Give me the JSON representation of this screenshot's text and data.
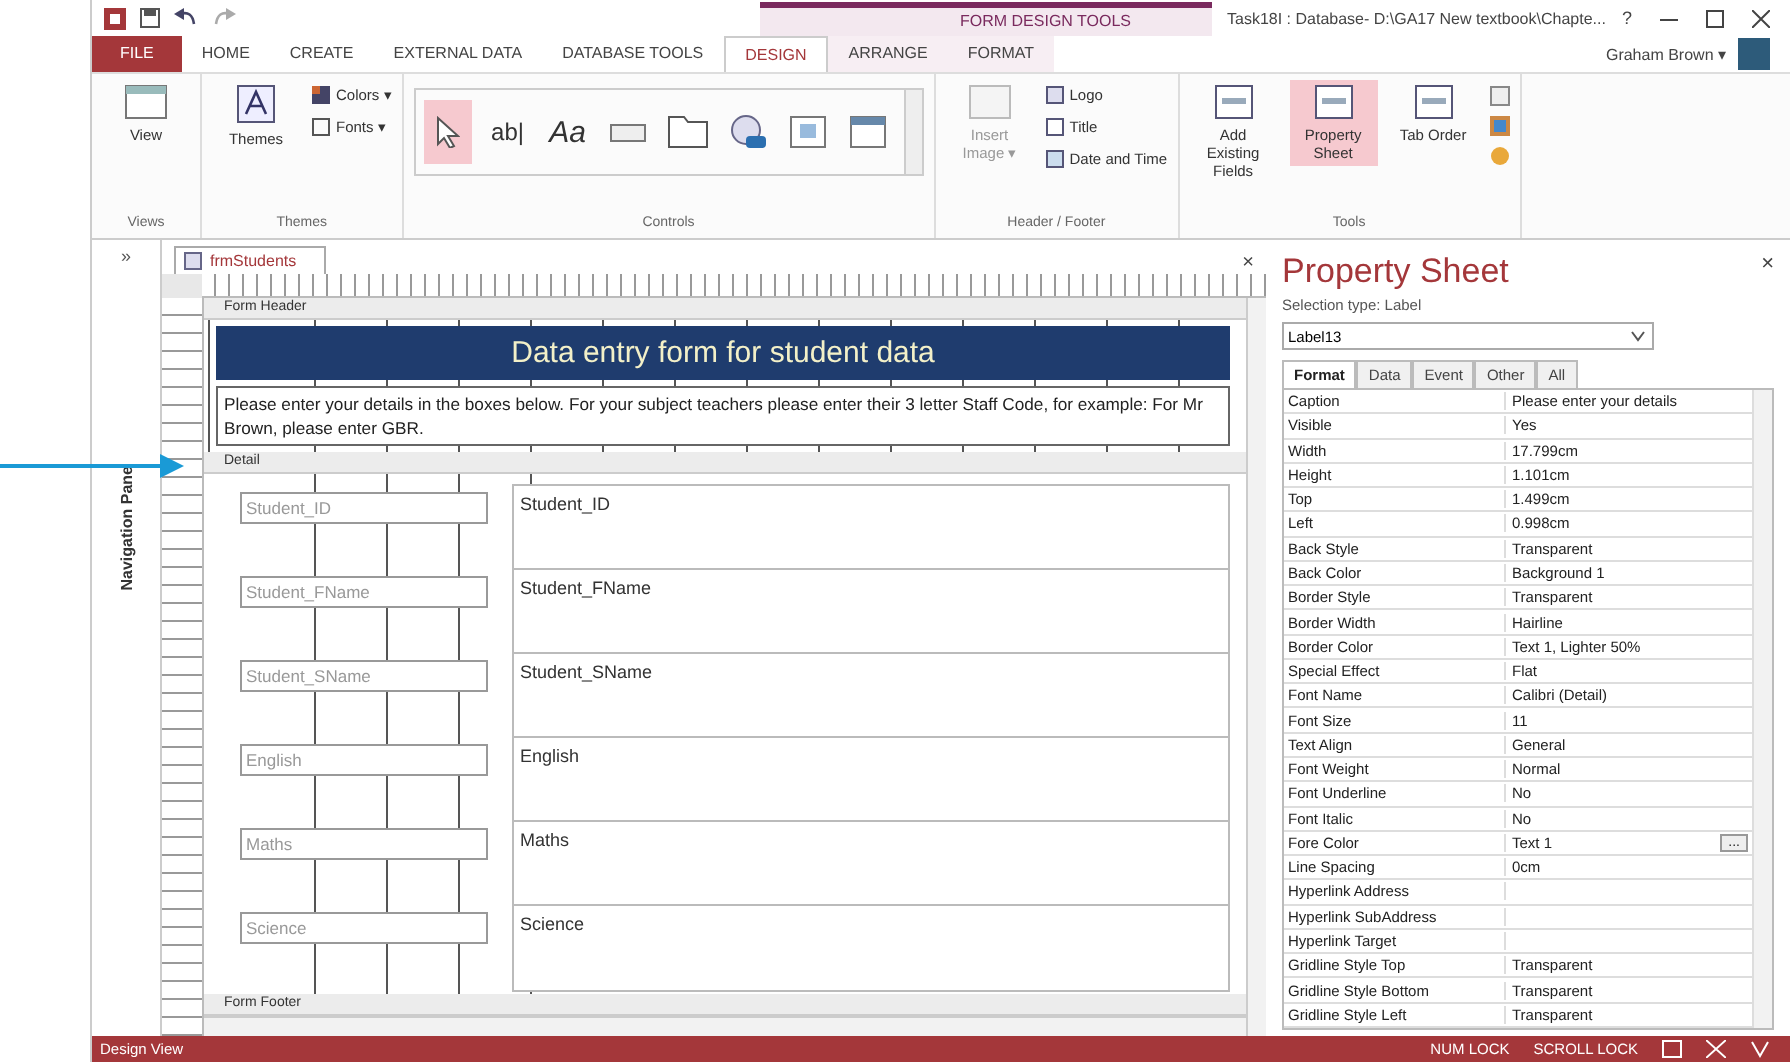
{
  "title_bar": {
    "context_label": "FORM DESIGN TOOLS",
    "title": "Task18I : Database- D:\\GA17 New textbook\\Chapte...",
    "help": "?",
    "user": "Graham Brown ▾"
  },
  "tabs": [
    {
      "label": "FILE",
      "selected": false,
      "kind": "file"
    },
    {
      "label": "HOME",
      "selected": false,
      "kind": "tab"
    },
    {
      "label": "CREATE",
      "selected": false,
      "kind": "tab"
    },
    {
      "label": "EXTERNAL DATA",
      "selected": false,
      "kind": "tab"
    },
    {
      "label": "DATABASE TOOLS",
      "selected": false,
      "kind": "tab"
    },
    {
      "label": "DESIGN",
      "selected": true,
      "kind": "context"
    },
    {
      "label": "ARRANGE",
      "selected": false,
      "kind": "context"
    },
    {
      "label": "FORMAT",
      "selected": false,
      "kind": "context"
    }
  ],
  "ribbon": {
    "views": {
      "name": "Views",
      "view": "View"
    },
    "themes": {
      "name": "Themes",
      "themes": "Themes",
      "colors": "Colors ▾",
      "fonts": "Fonts ▾"
    },
    "controls": {
      "name": "Controls",
      "items": [
        {
          "kind": "pointer",
          "selected": true
        },
        {
          "kind": "textbox",
          "label": "ab|",
          "selected": false
        },
        {
          "kind": "label",
          "label": "Aa",
          "selected": false
        },
        {
          "kind": "button",
          "selected": false
        },
        {
          "kind": "tab",
          "selected": false
        },
        {
          "kind": "hyperlink",
          "selected": false
        },
        {
          "kind": "frame",
          "selected": false
        },
        {
          "kind": "navigation",
          "selected": false
        }
      ]
    },
    "header_footer": {
      "name": "Header / Footer",
      "insert_image": "Insert Image ▾",
      "logo": "Logo",
      "title": "Title",
      "date_time": "Date and Time"
    },
    "tools": {
      "name": "Tools",
      "items": [
        {
          "label": "Add Existing Fields",
          "selected": false
        },
        {
          "label": "Property Sheet",
          "selected": true
        },
        {
          "label": "Tab Order",
          "selected": false
        }
      ]
    }
  },
  "navigation_pane": {
    "toggle": "»",
    "label": "Navigation Pane"
  },
  "document": {
    "tab": "frmStudents",
    "close": "×",
    "form_header": {
      "section": "Form Header",
      "title": "Data entry form for student data",
      "instructions": "Please enter your details in the boxes below. For your subject teachers please enter their 3 letter Staff Code, for example: For Mr Brown, please enter GBR."
    },
    "detail": {
      "section": "Detail",
      "fields": [
        {
          "label": "Student_ID",
          "control": "Student_ID"
        },
        {
          "label": "Student_FName",
          "control": "Student_FName"
        },
        {
          "label": "Student_SName",
          "control": "Student_SName"
        },
        {
          "label": "English",
          "control": "English"
        },
        {
          "label": "Maths",
          "control": "Maths"
        },
        {
          "label": "Science",
          "control": "Science"
        }
      ]
    },
    "form_footer": {
      "section": "Form Footer"
    }
  },
  "property_sheet": {
    "title": "Property Sheet",
    "close": "×",
    "selection_type": "Selection type:  Label",
    "selected_object": "Label13",
    "tabs": [
      {
        "label": "Format",
        "selected": true
      },
      {
        "label": "Data",
        "selected": false
      },
      {
        "label": "Event",
        "selected": false
      },
      {
        "label": "Other",
        "selected": false
      },
      {
        "label": "All",
        "selected": false
      }
    ],
    "rows": [
      {
        "name": "Caption",
        "value": "Please enter your details"
      },
      {
        "name": "Visible",
        "value": "Yes"
      },
      {
        "name": "Width",
        "value": "17.799cm"
      },
      {
        "name": "Height",
        "value": "1.101cm"
      },
      {
        "name": "Top",
        "value": "1.499cm"
      },
      {
        "name": "Left",
        "value": "0.998cm"
      },
      {
        "name": "Back Style",
        "value": "Transparent"
      },
      {
        "name": "Back Color",
        "value": "Background 1"
      },
      {
        "name": "Border Style",
        "value": "Transparent"
      },
      {
        "name": "Border Width",
        "value": "Hairline"
      },
      {
        "name": "Border Color",
        "value": "Text 1, Lighter 50%"
      },
      {
        "name": "Special Effect",
        "value": "Flat"
      },
      {
        "name": "Font Name",
        "value": "Calibri (Detail)"
      },
      {
        "name": "Font Size",
        "value": "11"
      },
      {
        "name": "Text Align",
        "value": "General"
      },
      {
        "name": "Font Weight",
        "value": "Normal"
      },
      {
        "name": "Font Underline",
        "value": "No"
      },
      {
        "name": "Font Italic",
        "value": "No"
      },
      {
        "name": "Fore Color",
        "value": "Text 1",
        "builder": "..."
      },
      {
        "name": "Line Spacing",
        "value": "0cm"
      },
      {
        "name": "Hyperlink Address",
        "value": ""
      },
      {
        "name": "Hyperlink SubAddress",
        "value": ""
      },
      {
        "name": "Hyperlink Target",
        "value": ""
      },
      {
        "name": "Gridline Style Top",
        "value": "Transparent"
      },
      {
        "name": "Gridline Style Bottom",
        "value": "Transparent"
      },
      {
        "name": "Gridline Style Left",
        "value": "Transparent"
      }
    ]
  },
  "status_bar": {
    "view": "Design View",
    "indicators": [
      "NUM LOCK",
      "SCROLL LOCK"
    ]
  }
}
